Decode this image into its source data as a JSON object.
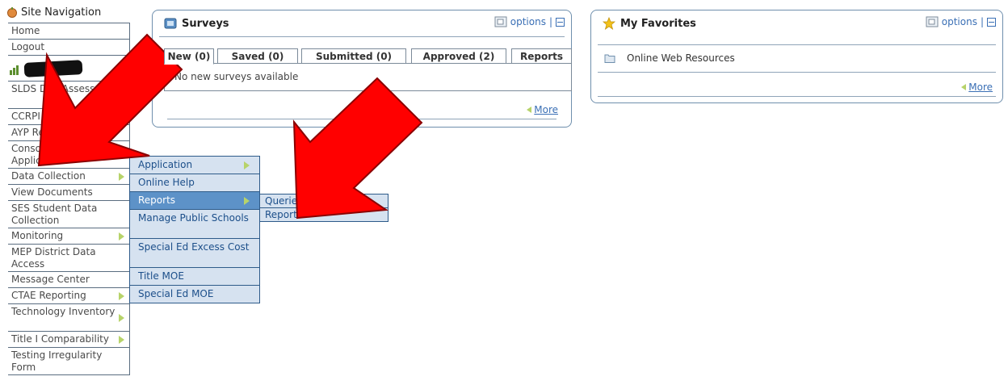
{
  "sidebar": {
    "title": "Site Navigation",
    "items_top": [
      {
        "label": "Home",
        "has_arrow": false
      },
      {
        "label": "Logout",
        "has_arrow": false
      }
    ],
    "items": [
      {
        "label": "SLDS Di... Assessm...",
        "has_arrow": false
      },
      {
        "label": "CCRPI",
        "has_arrow": false
      },
      {
        "label": "AYP Repo...",
        "has_arrow": false
      },
      {
        "label": "Consolidated Application",
        "has_arrow": true
      },
      {
        "label": "Data Collection",
        "has_arrow": true
      },
      {
        "label": "View Documents",
        "has_arrow": false
      },
      {
        "label": "SES Student Data Collection",
        "has_arrow": false
      },
      {
        "label": "Monitoring",
        "has_arrow": true
      },
      {
        "label": "MEP District Data Access",
        "has_arrow": false
      },
      {
        "label": "Message Center",
        "has_arrow": false
      },
      {
        "label": "CTAE Reporting",
        "has_arrow": true
      },
      {
        "label": "Technology Inventory",
        "has_arrow": true
      },
      {
        "label": "Title I Comparability",
        "has_arrow": true
      },
      {
        "label": "Testing Irregularity Form",
        "has_arrow": false
      }
    ]
  },
  "submenu1": {
    "items": [
      {
        "label": "Application",
        "has_arrow": true,
        "active": false
      },
      {
        "label": "Online Help",
        "has_arrow": false,
        "active": false
      },
      {
        "label": "Reports",
        "has_arrow": true,
        "active": true
      },
      {
        "label": "Manage Public Schools",
        "has_arrow": false,
        "active": false
      },
      {
        "label": "Special Ed Excess Cost",
        "has_arrow": false,
        "active": false
      },
      {
        "label": "Title MOE",
        "has_arrow": false,
        "active": false
      },
      {
        "label": "Special Ed MOE",
        "has_arrow": false,
        "active": false
      }
    ]
  },
  "submenu2": {
    "items": [
      {
        "label": "Queries"
      },
      {
        "label": "Reports"
      }
    ]
  },
  "surveys": {
    "title": "Surveys",
    "options_label": "options",
    "separator": "|",
    "tabs": [
      "New (0)",
      "Saved (0)",
      "Submitted (0)",
      "Approved (2)",
      "Reports"
    ],
    "empty_message": "No new surveys available",
    "more_label": "More"
  },
  "favorites": {
    "title": "My Favorites",
    "options_label": "options",
    "separator": "|",
    "items": [
      "Online Web Resources"
    ],
    "more_label": "More"
  },
  "colors": {
    "accent_blue": "#3a6fb5",
    "menu_bg": "#d6e2f0",
    "menu_active": "#5d92c8",
    "arrow_green": "#b7d36a",
    "annotation_red": "#ff0000"
  }
}
